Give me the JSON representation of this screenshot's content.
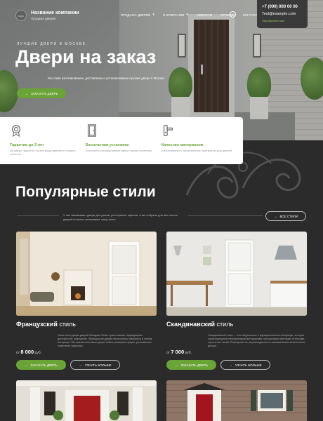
{
  "header": {
    "logo_text": "logo",
    "company_name": "Название компании",
    "company_tagline": "Продажа дверей",
    "nav": [
      {
        "label": "Продажа дверей",
        "has_caret": true
      },
      {
        "label": "О компании",
        "has_caret": true
      },
      {
        "label": "Новости",
        "has_caret": false
      },
      {
        "label": "Отзывы",
        "has_caret": false
      },
      {
        "label": "Контакты",
        "has_caret": false
      }
    ],
    "phone": "+7 (000) 000 00 00",
    "email": "Test@example.com",
    "callback": "Перезвоните мне"
  },
  "hero": {
    "subtitle": "Лучшие двери в Москве",
    "title": "Двери на заказ",
    "description": "Мы сами изготавливаем, доставляем и устанавливаем лучшие двери в Москве",
    "button": "Заказать дверь"
  },
  "features": [
    {
      "icon": "medal-icon",
      "title": "Гарантия до 3 лет",
      "text": "На дверь гарантия, на все виды дверей из нашего каталога"
    },
    {
      "icon": "door-icon",
      "title": "Бесплатная установка",
      "text": "Бесплатно устанавливаем двери нашим клиентам"
    },
    {
      "icon": "handle-icon",
      "title": "Качество материалов",
      "text": "Качественные и проверенные материалы для дверей"
    }
  ],
  "popular": {
    "title": "Популярные стили",
    "description": "У нас заказывают двери для домов, ресторанов, офисов, и мы собрали для вас список дверей которые заказывают чаще всего",
    "all_button": "Все стили"
  },
  "cards": [
    {
      "title_bold": "Французский",
      "title_light": "стиль",
      "description": "Такие конструкции дверей обладают более практичными, подходящими достоинства: помещение. Французский дизайн великолепно смотрится в любом интерьере. Мы можем изготовить двери любых размеров и форм, учитывая все пожелания заказчика.",
      "price_prefix": "от",
      "price": "8 000",
      "currency": "руб.",
      "order_button": "Заказать дверь",
      "more_button": "Узнать больше"
    },
    {
      "title_bold": "Скандинавский",
      "title_light": "стиль",
      "description": "Скандинавский стиль — это натуральные и функциональные интерьеры, которые характеризуются натуральными материалами, прекрасными светлыми оттенками, строгостью линий. Помещение не загромождается и с минимальным количеством декора.",
      "price_prefix": "от",
      "price": "7 000",
      "currency": "руб.",
      "order_button": "Заказать дверь",
      "more_button": "Узнать больше"
    }
  ],
  "colors": {
    "accent": "#6aa336",
    "dark_bg": "#2b2b2b",
    "card_white": "#ffffff"
  }
}
